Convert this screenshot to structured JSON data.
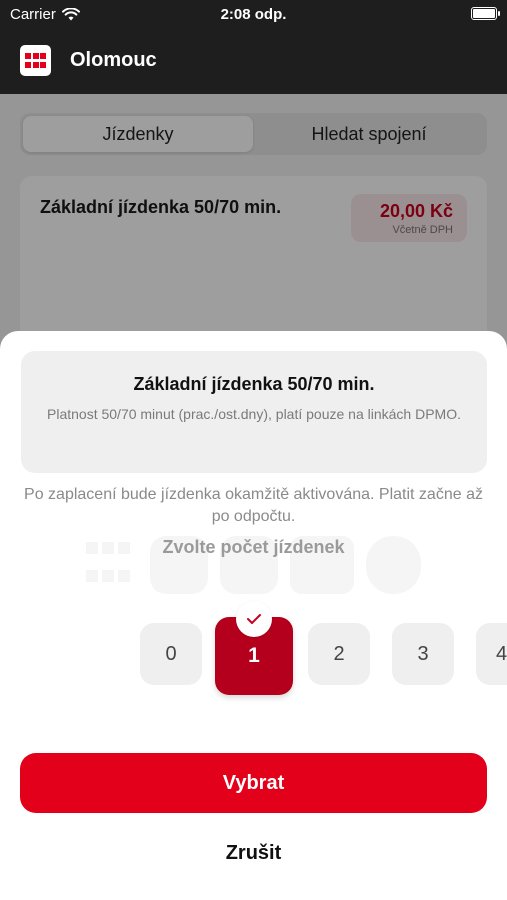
{
  "status_bar": {
    "carrier": "Carrier",
    "time": "2:08 odp."
  },
  "nav": {
    "title": "Olomouc",
    "logo_icon": "dpmo-logo-icon"
  },
  "background": {
    "tabs": [
      "Jízdenky",
      "Hledat spojení"
    ],
    "card": {
      "title": "Základní jízdenka 50/70 min.",
      "price": "20,00 Kč",
      "vat": "Včetně DPH",
      "number": "50"
    }
  },
  "sheet": {
    "ticket_title": "Základní jízdenka 50/70 min.",
    "ticket_desc": "Platnost 50/70 minut (prac./ost.dny), platí pouze na linkách DPMO.",
    "note": "Po zaplacení bude jízdenka okamžitě aktivována. Platit začne až po odpočtu.",
    "choose_label": "Zvolte počet jízdenek",
    "quantities": [
      "0",
      "1",
      "2",
      "3",
      "4"
    ],
    "selected_quantity": "1",
    "select_button": "Vybrat",
    "cancel_button": "Zrušit"
  },
  "colors": {
    "accent": "#e2001a",
    "selected": "#b5001d",
    "nav_bg": "#1e1e1e"
  }
}
